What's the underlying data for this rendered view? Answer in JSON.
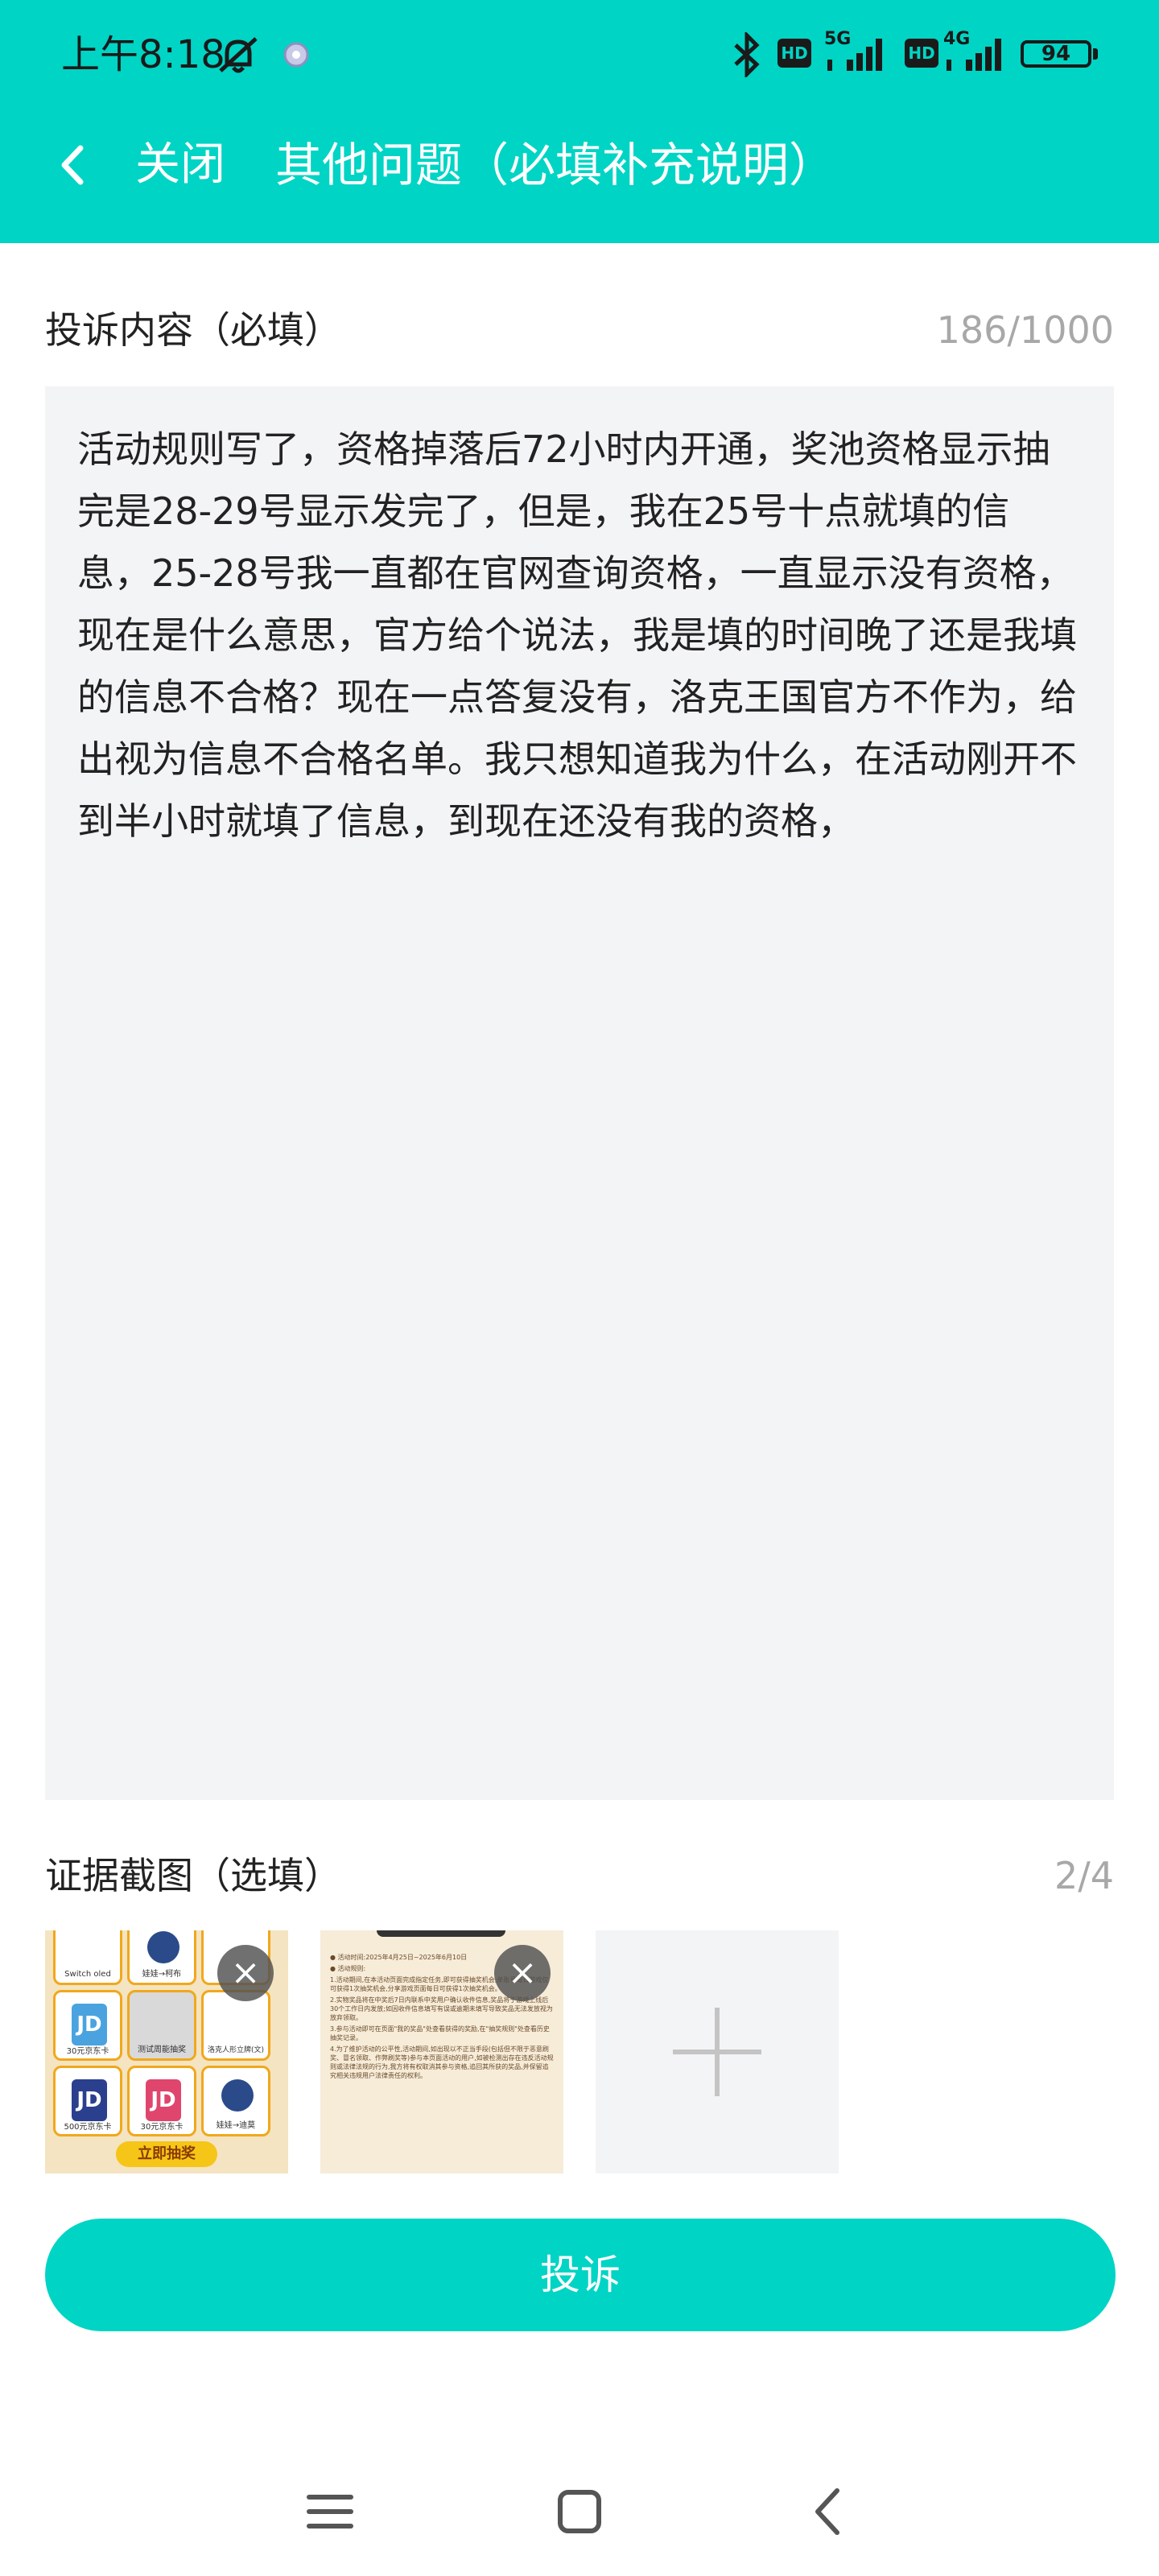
{
  "status_bar": {
    "time": "上午8:18",
    "battery": "94",
    "network_a": "5G",
    "network_b": "4G",
    "hd": "HD",
    "icons": [
      "mute-bell-icon",
      "app-notification-icon",
      "bluetooth-icon",
      "hd-icon",
      "signal-5g-icon",
      "hd-icon",
      "signal-4g-icon",
      "battery-icon"
    ]
  },
  "nav": {
    "back_icon": "chevron-left-icon",
    "close_label": "关闭",
    "title": "其他问题（必填补充说明）"
  },
  "complaint": {
    "label": "投诉内容（必填）",
    "counter": "186/1000",
    "text": "活动规则写了，资格掉落后72小时内开通，奖池资格显示抽完是28-29号显示发完了，但是，我在25号十点就填的信息，25-28号我一直都在官网查询资格，一直显示没有资格，现在是什么意思，官方给个说法，我是填的时间晚了还是我填的信息不合格？现在一点答复没有，洛克王国官方不作为，给出视为信息不合格名单。我只想知道我为什么，在活动刚开不到半小时就填了信息，到现在还没有我的资格，"
  },
  "evidence": {
    "label": "证据截图（选填）",
    "counter": "2/4",
    "thumbnails": [
      {
        "remove_icon": "close-icon",
        "tiles": [
          "Switch oled",
          "娃娃→柯布",
          "30元京东卡",
          "测试周能抽奖",
          "洛克人形立牌(文)",
          "500元京东卡",
          "30元京东卡",
          "娃娃→迪莫"
        ],
        "cta": "立即抽奖"
      },
      {
        "remove_icon": "close-icon",
        "lines": [
          "● 活动时间:2025年4月25日~2025年6月10日",
          "● 活动规则:",
          "1.活动期间,在本活动页面完成指定任务,即可获得抽奖机会;单账号每日游戏仅可获得1次抽奖机会,分享游戏页面每日可获得1次抽奖机会。",
          "2.实物奖品将在中奖后7日内联系中奖用户确认收件信息,奖品将于游戏上线后30个工作日内发放;如因收件信息填写有误或逾期未填写导致奖品无法发放视为放弃领取。",
          "3.参与活动即可在页面\"我的奖品\"处查看获得的奖励,在\"抽奖规则\"处查看历史抽奖记录。",
          "4.为了维护活动的公平性,活动期间,如出现以不正当手段(包括但不限于恶意刷奖、冒名领取、作弊刷奖等)参与本页面活动的用户,如被检测出存在违反活动规则或法律法规的行为,我方将有权取消其参与资格,追回其所获的奖品,并保留追究相关违规用户法律责任的权利。"
        ]
      }
    ],
    "add_icon": "plus-icon"
  },
  "submit": {
    "label": "投诉"
  },
  "system_nav": {
    "icons": [
      "menu-icon",
      "home-icon",
      "back-icon"
    ]
  },
  "colors": {
    "accent": "#00d4c4",
    "input_bg": "#f3f4f6",
    "muted_text": "#a8a8a8"
  }
}
